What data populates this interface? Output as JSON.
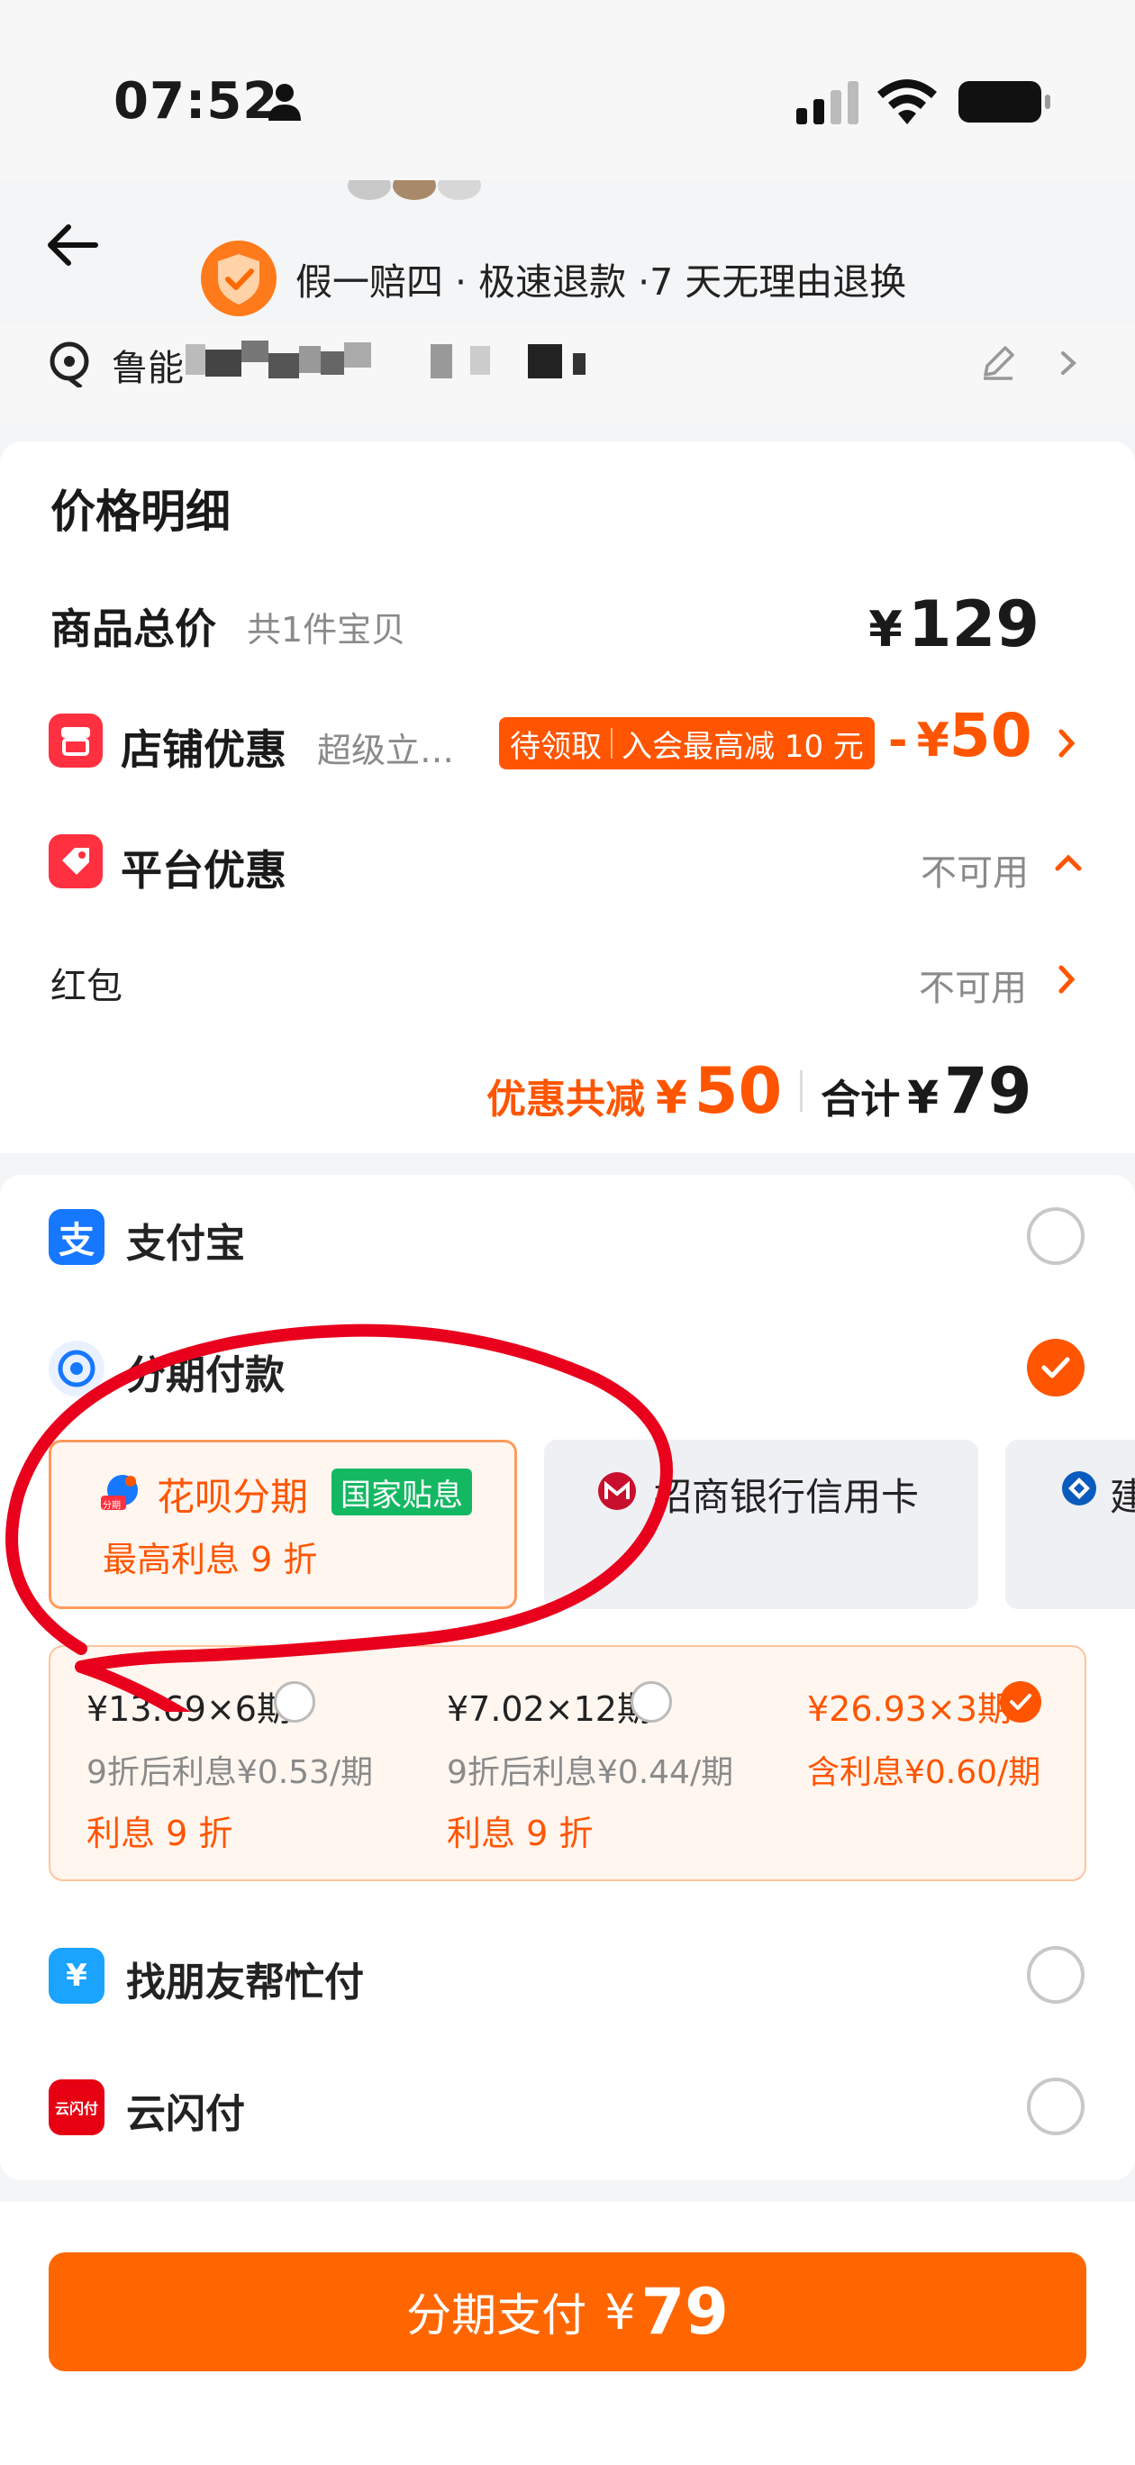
{
  "status_bar": {
    "time": "07:52"
  },
  "header": {
    "guarantee_text": "假一赔四 · 极速退款 ·7 天无理由退换",
    "address_text": "鲁能"
  },
  "price_detail": {
    "title": "价格明细",
    "goods_total_label": "商品总价",
    "goods_total_sub": "共1件宝贝",
    "goods_total_currency": "¥",
    "goods_total_value": "129",
    "store_discount_label": "店铺优惠",
    "store_discount_sub": "超级立…",
    "coupon_pending": "待领取",
    "coupon_text": "入会最高减 10 元",
    "store_discount_minus": "-",
    "store_discount_currency": "¥",
    "store_discount_value": "50",
    "platform_discount_label": "平台优惠",
    "platform_discount_status": "不可用",
    "hongbao_label": "红包",
    "hongbao_status": "不可用",
    "saving_label": "优惠共减",
    "saving_currency": "¥",
    "saving_value": "50",
    "total_label": "合计",
    "total_currency": "¥",
    "total_value": "79"
  },
  "payment": {
    "alipay_label": "支付宝",
    "alipay_icon": "支",
    "installment_label": "分期付款",
    "huabei_label": "花呗分期",
    "huabei_tag": "国家贴息",
    "huabei_sub": "最高利息 9 折",
    "huabei_icon_text": "分期",
    "cmb_label": "招商银行信用卡",
    "ccb_label": "建",
    "plans": [
      {
        "main": "¥13.69×6期",
        "note": "9折后利息¥0.53/期",
        "interest": "利息 9 折",
        "selected": false
      },
      {
        "main": "¥7.02×12期",
        "note": "9折后利息¥0.44/期",
        "interest": "利息 9 折",
        "selected": false
      },
      {
        "main": "¥26.93×3期",
        "note": "含利息¥0.60/期",
        "interest": "",
        "selected": true
      }
    ],
    "friend_pay_label": "找朋友帮忙付",
    "friend_pay_icon": "¥",
    "unionpay_label": "云闪付",
    "unionpay_icon": "云闪付"
  },
  "bottom": {
    "pay_label": "分期支付",
    "pay_currency": "¥",
    "pay_value": "79"
  },
  "colors": {
    "accent": "#ff5500",
    "button": "#ff6600",
    "alipay": "#1677ff",
    "green_tag": "#15b862",
    "annotation": "#e8001c"
  }
}
